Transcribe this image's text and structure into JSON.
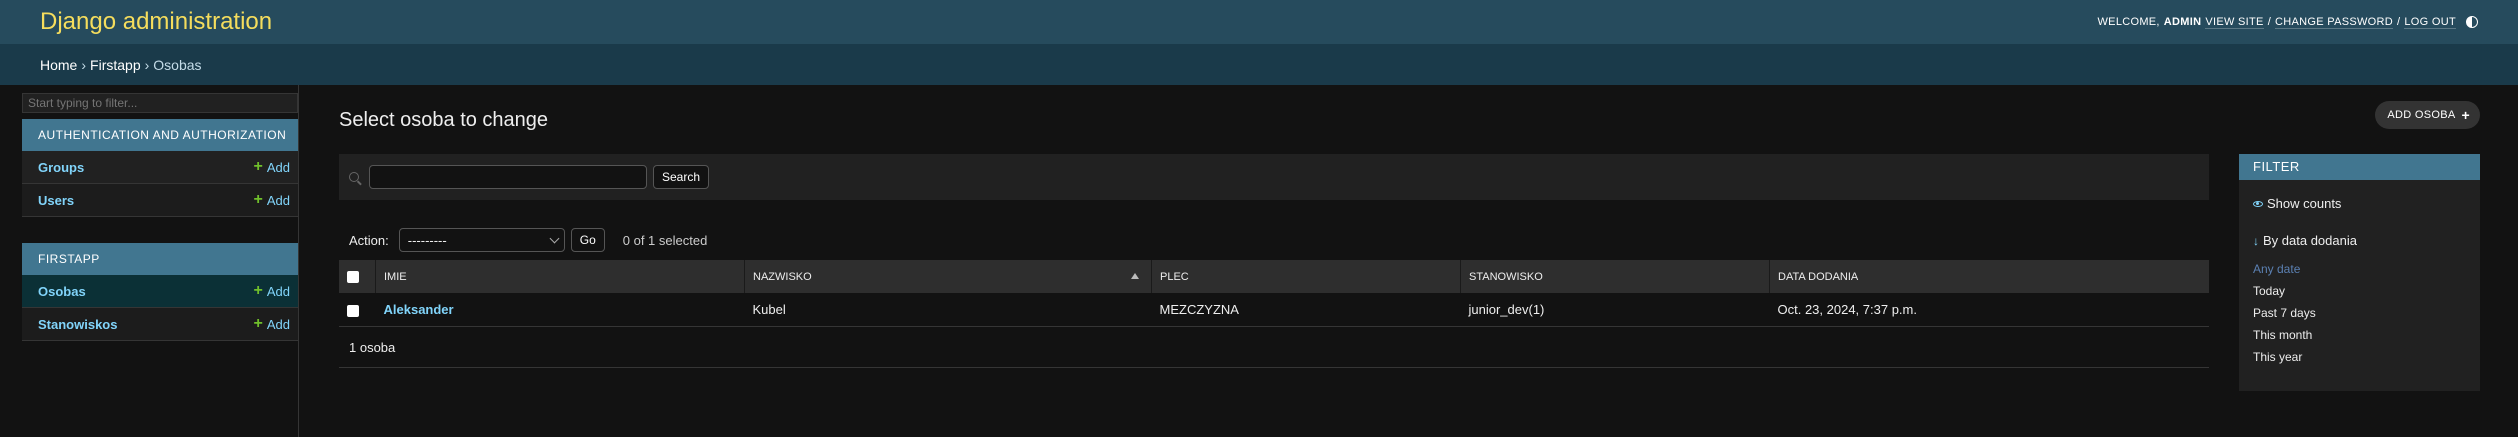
{
  "header": {
    "site_name": "Django administration",
    "welcome": "WELCOME,",
    "username": "ADMIN",
    "view_site": "VIEW SITE",
    "change_password": "CHANGE PASSWORD",
    "log_out": "LOG OUT",
    "sep": "/"
  },
  "breadcrumbs": {
    "home": "Home",
    "app": "Firstapp",
    "model": "Osobas",
    "sep": "›"
  },
  "sidebar": {
    "filter_placeholder": "Start typing to filter...",
    "modules": [
      {
        "caption": "AUTHENTICATION AND AUTHORIZATION",
        "rows": [
          {
            "name": "Groups",
            "add": "Add"
          },
          {
            "name": "Users",
            "add": "Add"
          }
        ]
      },
      {
        "caption": "FIRSTAPP",
        "rows": [
          {
            "name": "Osobas",
            "add": "Add"
          },
          {
            "name": "Stanowiskos",
            "add": "Add"
          }
        ]
      }
    ]
  },
  "main": {
    "title": "Select osoba to change",
    "add_button": "ADD OSOBA",
    "search_button": "Search",
    "search_value": "",
    "action_label": "Action:",
    "action_selected": "---------",
    "go_button": "Go",
    "counter": "0 of 1 selected",
    "columns": [
      "IMIE",
      "NAZWISKO",
      "PLEC",
      "STANOWISKO",
      "DATA DODANIA"
    ],
    "rows": [
      {
        "imie": "Aleksander",
        "nazwisko": "Kubel",
        "plec": "MEZCZYZNA",
        "stanowisko": "junior_dev(1)",
        "data": "Oct. 23, 2024, 7:37 p.m."
      }
    ],
    "paginator": "1 osoba"
  },
  "filter": {
    "title": "FILTER",
    "show_counts": "Show counts",
    "by_title": "By data dodania",
    "choices": [
      "Any date",
      "Today",
      "Past 7 days",
      "This month",
      "This year"
    ]
  },
  "colors": {
    "header_bg": "#264b5d",
    "site_name": "#f5dd5d",
    "breadcrumbs_bg": "#1a3a4a",
    "module_caption": "#417690",
    "link": "#81d4fa",
    "add_plus": "#70bf2b",
    "body_bg": "#121212"
  }
}
